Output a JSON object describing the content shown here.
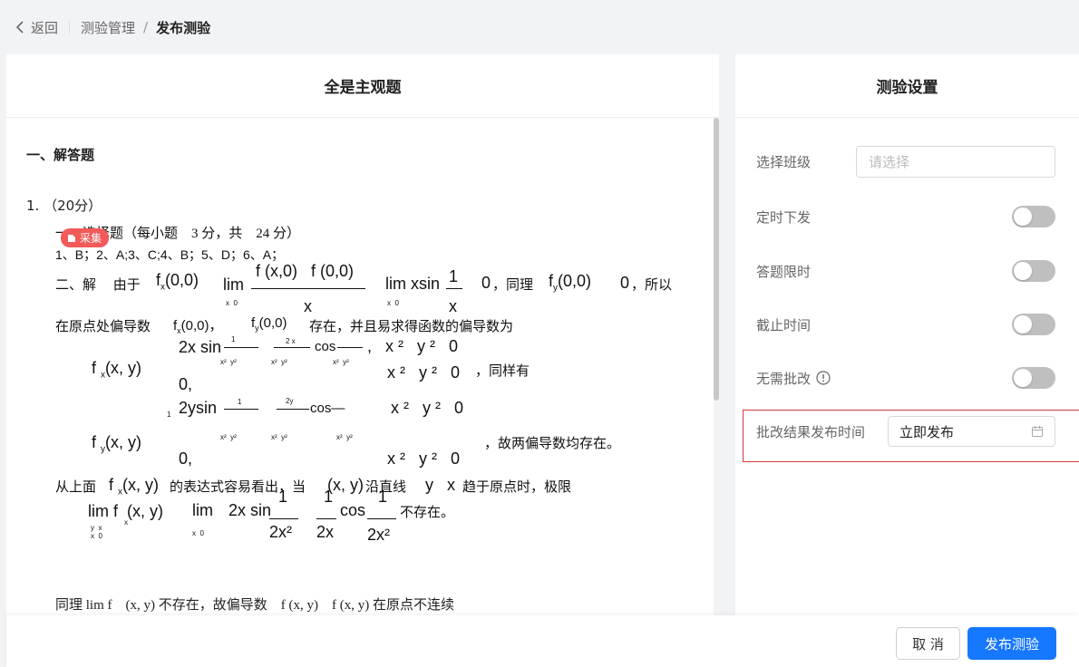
{
  "breadcrumb": {
    "back_label": "返回",
    "parent": "测验管理",
    "separator": "/",
    "current": "发布测验"
  },
  "left_panel": {
    "title": "全是主观题",
    "section_title": "一、解答题",
    "question_number": "1. （20分）",
    "collect_tag": "采集",
    "answer_lines": {
      "l1": "一、选择题（每小题　3 分，共　24 分）",
      "l2": "1、B；2、A;3、C;4、B；5、D；6、A；",
      "l3_prefix": "二、解　 由于",
      "l3_suffix": "，同理",
      "l3_end": "，所以",
      "l4_prefix": "在原点处偏导数",
      "l4_suffix": "存在，并且易求得函数的偏导数为",
      "l5_suffix": "，同样有",
      "l6_suffix": "，故两偏导数均存在。",
      "l7_prefix": "从上面",
      "l7_mid": "的表达式容易看出，当",
      "l7_mid2": "沿直线",
      "l7_suffix": "趋于原点时，极限",
      "l8_suffix": "不存在。",
      "l9": "同理 lim f　(x, y) 不存在，故偏导数　f (x, y)　f (x, y) 在原点不连续"
    }
  },
  "right_panel": {
    "title": "测验设置",
    "class_select": {
      "label": "选择班级",
      "placeholder": "请选择"
    },
    "scheduled_release": {
      "label": "定时下发",
      "enabled": false
    },
    "time_limit": {
      "label": "答题限时",
      "enabled": false
    },
    "deadline": {
      "label": "截止时间",
      "enabled": false
    },
    "no_grading": {
      "label": "无需批改",
      "enabled": false
    },
    "result_publish_time": {
      "label": "批改结果发布时间",
      "value": "立即发布"
    }
  },
  "footer": {
    "cancel_label": "取 消",
    "publish_label": "发布测验"
  },
  "colors": {
    "primary": "#1677ff",
    "highlight_border": "#d63a3a",
    "tag": "#f25a5a",
    "switch_off": "#bfbfbf"
  }
}
